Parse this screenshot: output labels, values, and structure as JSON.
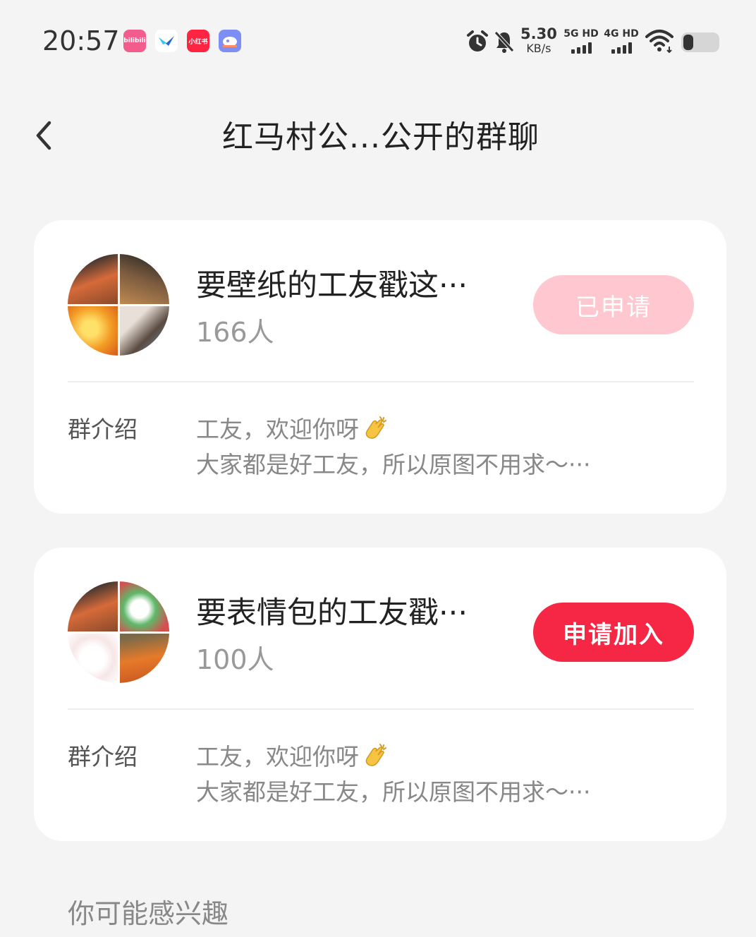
{
  "status_bar": {
    "time": "20:57",
    "apps": [
      {
        "icon": "bilibili-icon",
        "label": "bilibili",
        "color": "#f25d8e"
      },
      {
        "icon": "fliggy-icon",
        "label": "",
        "color": "#ffffff"
      },
      {
        "icon": "xiaohongshu-icon",
        "label": "小红书",
        "color": "#ff2442"
      },
      {
        "icon": "app-icon",
        "label": "",
        "color": "#6a8cff"
      }
    ],
    "net_speed": "5.30",
    "net_unit": "KB/s",
    "sim1": "5G HD",
    "sim2": "4G HD"
  },
  "header": {
    "title": "红马村公...公开的群聊"
  },
  "groups": [
    {
      "name": "要壁纸的工友戳这···",
      "count": "166人",
      "action": "已申请",
      "intro_label": "群介绍",
      "intro_line1": "工友，欢迎你呀",
      "intro_line2": "大家都是好工友，所以原图不用求～···"
    },
    {
      "name": "要表情包的工友戳···",
      "count": "100人",
      "action": "申请加入",
      "intro_label": "群介绍",
      "intro_line1": "工友，欢迎你呀",
      "intro_line2": "大家都是好工友，所以原图不用求～···"
    }
  ],
  "section": {
    "title": "你可能感兴趣"
  },
  "colors": {
    "primary": "#f52744",
    "applied": "#ffc7cf",
    "background": "#f4f4f4"
  }
}
